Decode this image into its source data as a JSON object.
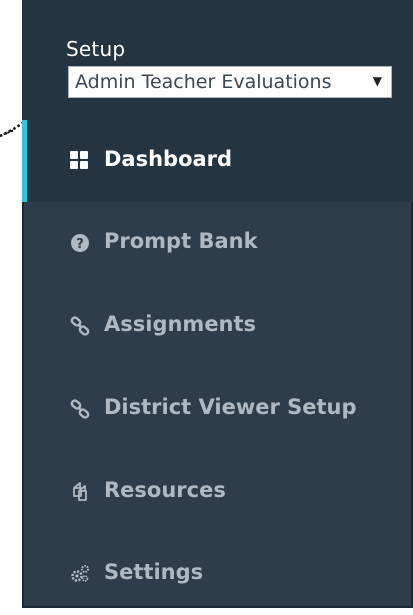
{
  "setup": {
    "label": "Setup",
    "selected_value": "Admin Teacher Evaluations"
  },
  "nav": {
    "items": [
      {
        "label": "Dashboard",
        "icon": "dashboard-icon",
        "active": true
      },
      {
        "label": "Prompt Bank",
        "icon": "question-circle-icon",
        "active": false
      },
      {
        "label": "Assignments",
        "icon": "link-icon",
        "active": false
      },
      {
        "label": "District Viewer Setup",
        "icon": "link-icon",
        "active": false
      },
      {
        "label": "Resources",
        "icon": "copy-icon",
        "active": false
      },
      {
        "label": "Settings",
        "icon": "gears-icon",
        "active": false
      }
    ]
  },
  "colors": {
    "panel_bg": "#2d3d4c",
    "active_bg": "#253441",
    "accent": "#31c6d8",
    "inactive_text": "#aeb9c3",
    "active_text": "#ffffff"
  }
}
